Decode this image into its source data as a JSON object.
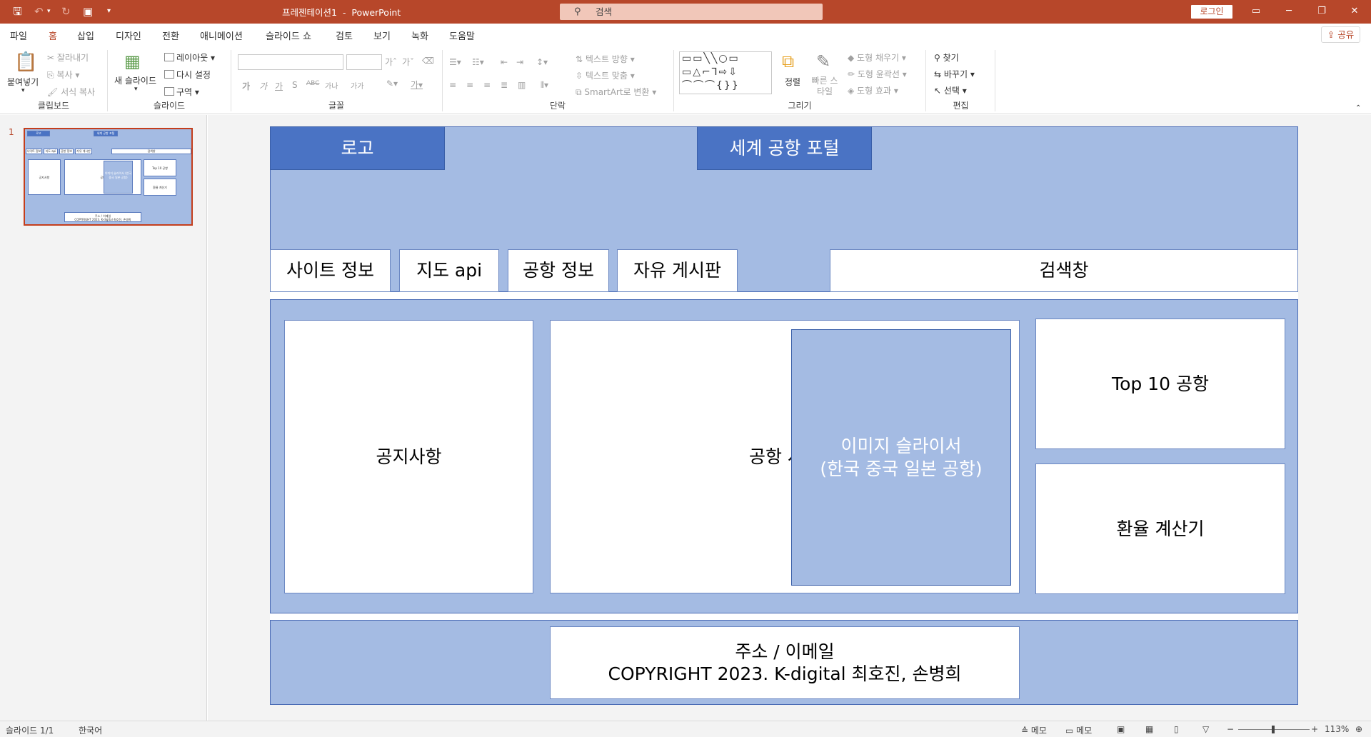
{
  "app": {
    "doc_title": "프레젠테이션1  -  PowerPoint",
    "search_placeholder": "검색",
    "login_label": "로그인",
    "share_label": "공유"
  },
  "menu_tabs": [
    "파일",
    "홈",
    "삽입",
    "디자인",
    "전환",
    "애니메이션",
    "슬라이드 쇼",
    "검토",
    "보기",
    "녹화",
    "도움말"
  ],
  "ribbon": {
    "clipboard": {
      "paste": "붙여넣기",
      "cut": "잘라내기",
      "copy": "복사",
      "format_painter": "서식 복사",
      "label": "클립보드"
    },
    "slides": {
      "new_slide": "새 슬라이드",
      "layout": "레이아웃",
      "reset": "다시 설정",
      "section": "구역",
      "label": "슬라이드"
    },
    "font": {
      "label": "글꼴",
      "bold": "가",
      "italic": "가",
      "underline": "가",
      "shadow": "S",
      "strike": "ABC",
      "spacing": "가나",
      "case": "가가",
      "grow": "가",
      "shrink": "가",
      "clear": "가"
    },
    "paragraph": {
      "text_direction": "텍스트 방향",
      "align_text": "텍스트 맞춤",
      "smartart": "SmartArt로 변환",
      "label": "단락"
    },
    "drawing": {
      "arrange": "정렬",
      "quick_styles": "빠른 스타일",
      "fill": "도형 채우기",
      "outline": "도형 윤곽선",
      "effects": "도형 효과",
      "label": "그리기"
    },
    "editing": {
      "find": "찾기",
      "replace": "바꾸기",
      "select": "선택",
      "label": "편집"
    }
  },
  "slide_panel": {
    "slide_number": "1"
  },
  "slide": {
    "logo": "로고",
    "portal_title": "세계 공항 포털",
    "nav": [
      "사이트 정보",
      "지도 api",
      "공항 정보",
      "자유 게시판"
    ],
    "search": "검색창",
    "notice": "공지사항",
    "photos": "공항 사진",
    "slider": "이미지 슬라이서\n(한국 중국 일본 공항)",
    "top10": "Top 10 공항",
    "exchange": "환율 계산기",
    "footer": "주소 / 이메일\nCOPYRIGHT 2023. K-digital 최호진, 손병희"
  },
  "thumb": {
    "logo": "로고",
    "title": "세계 공항 포털",
    "nav": [
      "사이트 정보",
      "지도 api",
      "공항 정보",
      "자유 게시판"
    ],
    "search": "검색창",
    "notice": "공지사항",
    "photos": "공항",
    "slider": "이미지 슬라이서 (한국 중국 일본 공항)",
    "top10": "Top 10 공항",
    "exchange": "환율 계산기",
    "footer": "주소 / 이메일\nCOPYRIGHT 2023. K-digital 최호진, 손병희"
  },
  "status": {
    "slide_info": "슬라이드 1/1",
    "language": "한국어",
    "notes1": "메모",
    "notes2": "메모",
    "zoom": "113%"
  },
  "colors": {
    "accent": "#b7472a",
    "slide_panel": "#a4bbe3",
    "slide_dark": "#4a73c4"
  }
}
